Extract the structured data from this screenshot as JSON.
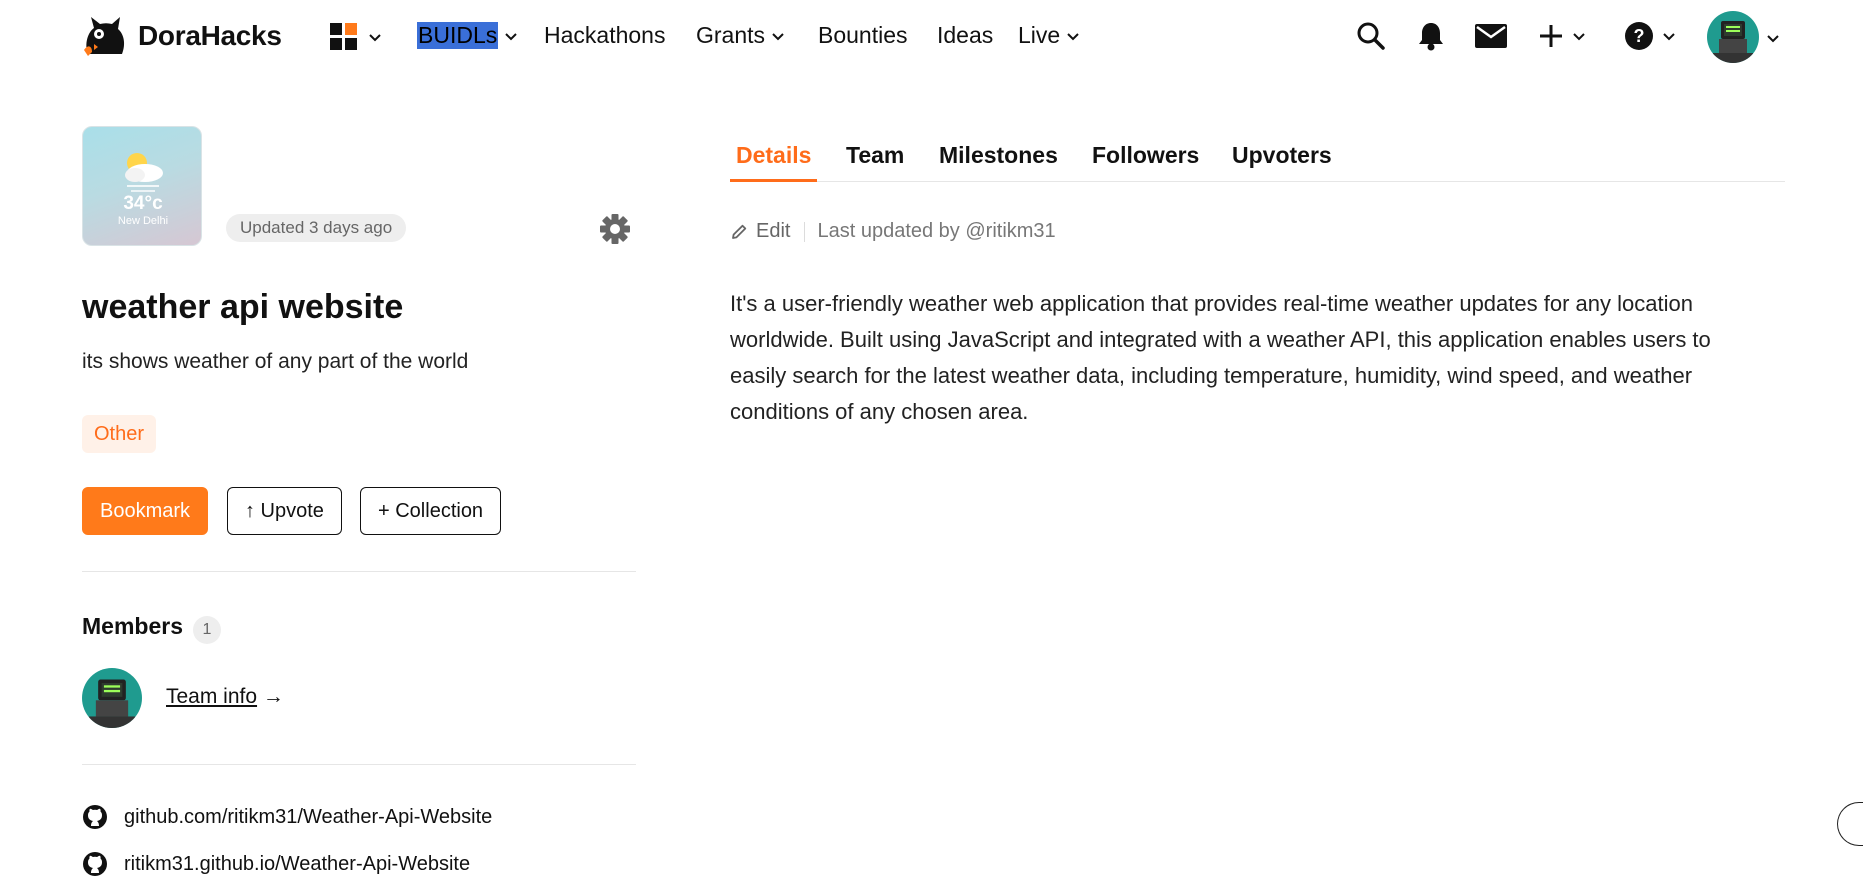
{
  "header": {
    "brand": "DoraHacks",
    "nav": [
      {
        "label": "BUIDLs",
        "has_dropdown": true,
        "selected_text": true
      },
      {
        "label": "Hackathons",
        "has_dropdown": false
      },
      {
        "label": "Grants",
        "has_dropdown": true
      },
      {
        "label": "Bounties",
        "has_dropdown": false
      },
      {
        "label": "Ideas",
        "has_dropdown": false
      },
      {
        "label": "Live",
        "has_dropdown": true
      }
    ],
    "icons": [
      "apps-grid-icon",
      "search-icon",
      "bell-icon",
      "mail-icon",
      "plus-icon",
      "help-icon",
      "avatar"
    ]
  },
  "project": {
    "cover": {
      "temp": "34°c",
      "city": "New Delhi"
    },
    "updated": "Updated 3 days ago",
    "title": "weather api website",
    "subtitle": "its shows weather of any part of the world",
    "tag": "Other",
    "actions": {
      "bookmark": "Bookmark",
      "upvote": "↑ Upvote",
      "collection": "+ Collection"
    },
    "members": {
      "title": "Members",
      "count": "1",
      "team_link": "Team info",
      "arrow": "→"
    },
    "links": [
      "github.com/ritikm31/Weather-Api-Website",
      "ritikm31.github.io/Weather-Api-Website"
    ]
  },
  "tabs": [
    "Details",
    "Team",
    "Milestones",
    "Followers",
    "Upvoters"
  ],
  "details": {
    "edit_label": "Edit",
    "last_updated": "Last updated by @ritikm31",
    "description": "It's a user-friendly weather web application that provides real-time weather updates for any location worldwide. Built using JavaScript and integrated with a weather API, this application enables users to easily search for the latest weather data, including temperature, humidity, wind speed, and weather conditions of any chosen area."
  },
  "colors": {
    "accent": "#ff7a1a",
    "tag_bg": "#fff1e8",
    "selection": "#3a6fd8"
  }
}
